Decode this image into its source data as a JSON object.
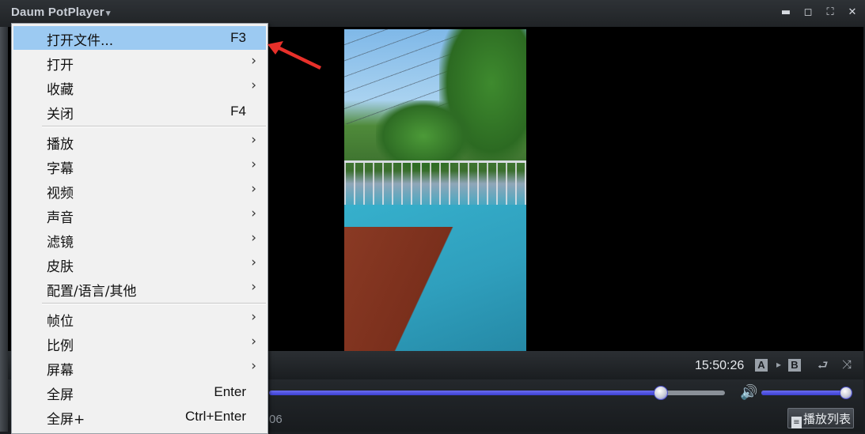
{
  "window": {
    "title": "Daum PotPlayer",
    "title_caret": "▾",
    "buttons": [
      "▬",
      "◻",
      "⛶",
      "✕"
    ]
  },
  "menu": {
    "items": [
      {
        "label": "打开文件...",
        "shortcut": "F3",
        "submenu": false,
        "highlighted": true
      },
      {
        "label": "打开",
        "shortcut": "",
        "submenu": true
      },
      {
        "label": "收藏",
        "shortcut": "",
        "submenu": true
      },
      {
        "label": "关闭",
        "shortcut": "F4",
        "submenu": false
      },
      {
        "label": "播放",
        "shortcut": "",
        "submenu": true
      },
      {
        "label": "字幕",
        "shortcut": "",
        "submenu": true
      },
      {
        "label": "视频",
        "shortcut": "",
        "submenu": true
      },
      {
        "label": "声音",
        "shortcut": "",
        "submenu": true
      },
      {
        "label": "滤镜",
        "shortcut": "",
        "submenu": true
      },
      {
        "label": "皮肤",
        "shortcut": "",
        "submenu": true
      },
      {
        "label": "配置/语言/其他",
        "shortcut": "",
        "submenu": true
      },
      {
        "label": "帧位",
        "shortcut": "",
        "submenu": true
      },
      {
        "label": "比例",
        "shortcut": "",
        "submenu": true
      },
      {
        "label": "屏幕",
        "shortcut": "",
        "submenu": true
      },
      {
        "label": "全屏",
        "shortcut": "Enter",
        "submenu": false
      },
      {
        "label": "全屏+",
        "shortcut": "Ctrl+Enter",
        "submenu": false
      }
    ],
    "submenu_arrow": "›"
  },
  "controls": {
    "clock": "15:50:26",
    "a_label": "A",
    "b_label": "B",
    "ab_separator": "▸",
    "repeat_icon": "⮐",
    "shuffle_icon": "⤨",
    "seek_progress": 0.86,
    "volume_level": 0.99,
    "partial_time": "06",
    "volume_icon": "🔊",
    "playlist_label": "播放列表",
    "playlist_icon": "≡"
  },
  "colors": {
    "menu_highlight": "#9ccaf2",
    "annotation_arrow": "#e8302a",
    "slider_fill": "#3b3fd2"
  }
}
